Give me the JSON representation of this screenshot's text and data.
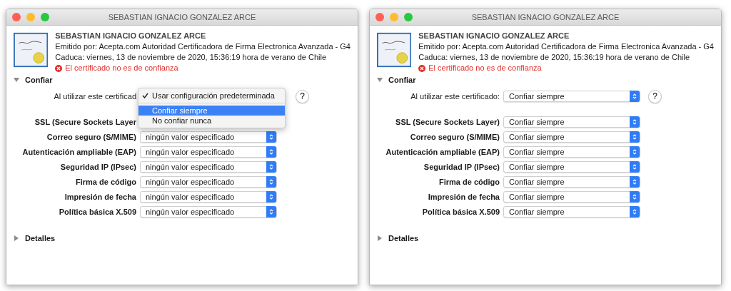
{
  "windows": [
    {
      "title": "SEBASTIAN IGNACIO GONZALEZ ARCE",
      "cert": {
        "name": "SEBASTIAN IGNACIO GONZALEZ ARCE",
        "issuer": "Emitido por: Acepta.com Autoridad Certificadora de Firma Electronica Avanzada - G4",
        "expires": "Caduca: viernes, 13 de noviembre de 2020, 15:36:19 hora de verano de Chile",
        "warning": "El certificado no es de confianza"
      },
      "trust": {
        "label": "Confiar",
        "expanded": true,
        "usage_label": "Al utilizar este certificad",
        "help": "?",
        "menu": [
          {
            "label": "Usar configuración predeterminada",
            "checked": true,
            "selected": false
          },
          {
            "label": "Confiar siempre",
            "checked": false,
            "selected": true
          },
          {
            "label": "No confiar nunca",
            "checked": false,
            "selected": false
          }
        ],
        "rows": [
          {
            "label": "SSL (Secure Sockets Layer"
          },
          {
            "label": "Correo seguro (S/MIME)",
            "value": "ningún valor especificado"
          },
          {
            "label": "Autenticación ampliable (EAP)",
            "value": "ningún valor especificado"
          },
          {
            "label": "Seguridad IP (IPsec)",
            "value": "ningún valor especificado"
          },
          {
            "label": "Firma de código",
            "value": "ningún valor especificado"
          },
          {
            "label": "Impresión de fecha",
            "value": "ningún valor especificado"
          },
          {
            "label": "Política básica X.509",
            "value": "ningún valor especificado"
          }
        ]
      },
      "details": {
        "label": "Detalles",
        "expanded": false
      }
    },
    {
      "title": "SEBASTIAN IGNACIO GONZALEZ ARCE",
      "cert": {
        "name": "SEBASTIAN IGNACIO GONZALEZ ARCE",
        "issuer": "Emitido por: Acepta.com Autoridad Certificadora de Firma Electronica Avanzada - G4",
        "expires": "Caduca: viernes, 13 de noviembre de 2020, 15:36:19 hora de verano de Chile",
        "warning": "El certificado no es de confianza"
      },
      "trust": {
        "label": "Confiar",
        "expanded": true,
        "usage_label": "Al utilizar este certificado:",
        "usage_value": "Confiar siempre",
        "help": "?",
        "rows": [
          {
            "label": "SSL (Secure Sockets Layer)",
            "value": "Confiar siempre"
          },
          {
            "label": "Correo seguro (S/MIME)",
            "value": "Confiar siempre"
          },
          {
            "label": "Autenticación ampliable (EAP)",
            "value": "Confiar siempre"
          },
          {
            "label": "Seguridad IP (IPsec)",
            "value": "Confiar siempre"
          },
          {
            "label": "Firma de código",
            "value": "Confiar siempre"
          },
          {
            "label": "Impresión de fecha",
            "value": "Confiar siempre"
          },
          {
            "label": "Política básica X.509",
            "value": "Confiar siempre"
          }
        ]
      },
      "details": {
        "label": "Detalles",
        "expanded": false
      }
    }
  ]
}
